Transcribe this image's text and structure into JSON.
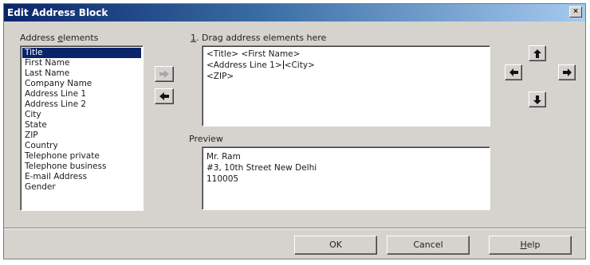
{
  "window": {
    "title": "Edit Address Block",
    "close_glyph": "×"
  },
  "elements": {
    "label_prefix": "Address ",
    "label_accel": "e",
    "label_suffix": "lements",
    "items": [
      "Title",
      "First Name",
      "Last Name",
      "Company Name",
      "Address Line 1",
      "Address Line 2",
      "City",
      "State",
      "ZIP",
      "Country",
      "Telephone private",
      "Telephone business",
      "E-mail Address",
      "Gender"
    ],
    "selected_index": 0
  },
  "transfer": {
    "add_icon": "arrow-right-icon",
    "remove_icon": "arrow-left-icon"
  },
  "drag": {
    "label_number": "1",
    "label_text": ". Drag address elements here",
    "line1": "<Title> <First Name>",
    "line2_a": "<Address Line 1>",
    "line2_b": "<City>",
    "line3": "<ZIP>"
  },
  "move_buttons": {
    "up_icon": "arrow-up-icon",
    "left_icon": "arrow-left-icon",
    "right_icon": "arrow-right-icon",
    "down_icon": "arrow-down-icon"
  },
  "preview": {
    "label": "Preview",
    "lines": [
      "Mr. Ram",
      "#3, 10th Street New Delhi",
      "110005"
    ]
  },
  "buttons": {
    "ok": "OK",
    "cancel": "Cancel",
    "help_accel": "H",
    "help_rest": "elp"
  },
  "colors": {
    "dialog_bg": "#d6d3ce",
    "title_start": "#0a246a",
    "title_end": "#a6caf0",
    "selection": "#0a246a"
  }
}
